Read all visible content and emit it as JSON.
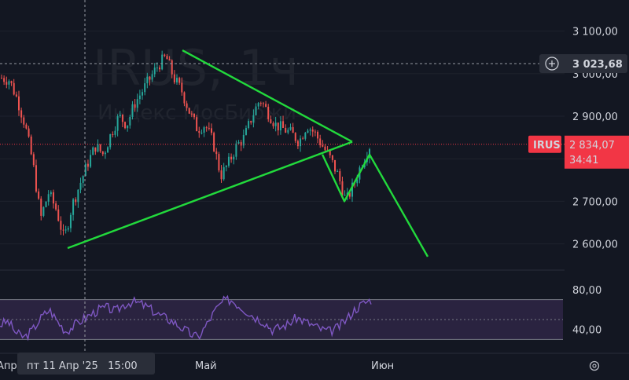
{
  "chart_data": {
    "type": "candlestick",
    "symbol": "IRUS",
    "interval": "1ч",
    "watermark_symbol": "IRUS, 1ч",
    "watermark_name": "Индекс МосБиржи",
    "price_axis": {
      "ticks": [
        "3 100,00",
        "3 000,00",
        "2 900,00",
        "2 800,00",
        "2 700,00",
        "2 600,00"
      ],
      "tick_values": [
        3100,
        3000,
        2900,
        2800,
        2700,
        2600
      ],
      "ylim": [
        2555,
        3140
      ]
    },
    "rsi_axis": {
      "ticks": [
        "80,00",
        "40,00"
      ],
      "tick_values": [
        80,
        40
      ],
      "ylim": [
        20,
        95
      ],
      "band": [
        30,
        70
      ],
      "mid": 50
    },
    "time_axis": {
      "ticks": [
        "Апр",
        "Май",
        "Июн"
      ],
      "crosshair_label": "пт 11 Апр '25   15:00"
    },
    "crosshair": {
      "price": "3 023,68",
      "price_value": 3023.68
    },
    "last_price": {
      "symbol": "IRUS",
      "price": "2 834,07",
      "price_value": 2834.07,
      "countdown": "34:41"
    },
    "close_path": [
      2990,
      2985,
      2940,
      2880,
      2790,
      2660,
      2720,
      2680,
      2610,
      2690,
      2740,
      2790,
      2830,
      2810,
      2860,
      2900,
      2880,
      2930,
      2960,
      2990,
      3020,
      3040,
      2990,
      2960,
      2910,
      2870,
      2880,
      2840,
      2760,
      2790,
      2830,
      2850,
      2900,
      2940,
      2910,
      2880,
      2870,
      2860,
      2840,
      2880,
      2860,
      2830,
      2800,
      2760,
      2700,
      2740,
      2790,
      2830
    ],
    "rsi_path": [
      45,
      48,
      36,
      32,
      40,
      52,
      60,
      48,
      38,
      44,
      50,
      55,
      60,
      62,
      58,
      65,
      68,
      66,
      62,
      56,
      52,
      48,
      42,
      36,
      32,
      44,
      58,
      68,
      70,
      64,
      58,
      52,
      48,
      40,
      42,
      46,
      52,
      48,
      44,
      40,
      38,
      42,
      50,
      60,
      66,
      70
    ],
    "trend_lines": [
      [
        [
          2590,
          1
        ],
        [
          2840,
          1
        ]
      ],
      [
        [
          3055,
          1
        ],
        [
          2840,
          1
        ]
      ],
      [
        [
          2810,
          1
        ],
        [
          2700,
          1
        ],
        [
          2810,
          1
        ],
        [
          2570,
          1
        ]
      ]
    ],
    "colors": {
      "background": "#131722",
      "up": "#26a69a",
      "down": "#ef5350",
      "trend_line": "#22d93c",
      "rsi_line": "#7e57c2",
      "rsi_band": "#2a2340",
      "price_label": "#f23645"
    }
  },
  "toolbar": {
    "add_icon": "plus-circle-icon",
    "settings_icon": "gear-icon"
  }
}
